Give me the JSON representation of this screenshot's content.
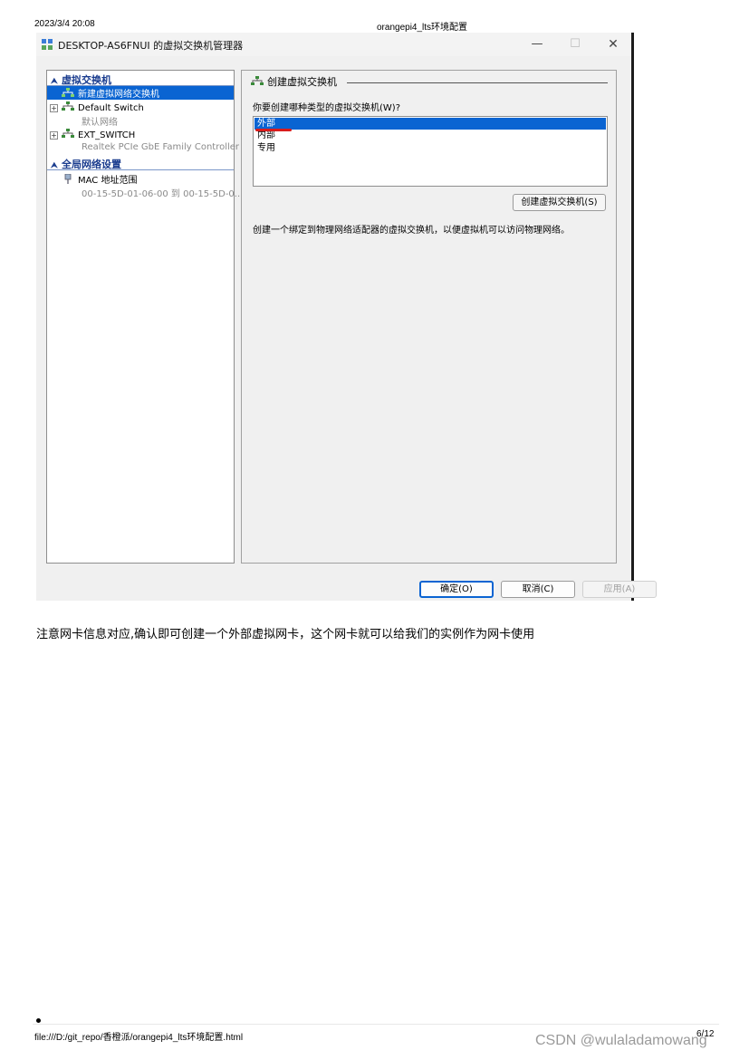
{
  "print_header": {
    "datetime": "2023/3/4 20:08",
    "doc_title": "orangepi4_lts环境配置"
  },
  "window": {
    "title": "DESKTOP-AS6FNUI 的虚拟交换机管理器",
    "minimize": "—",
    "maximize": "☐",
    "close": "✕"
  },
  "tree": {
    "section_switches": "虚拟交换机",
    "new_switch": "新建虚拟网络交换机",
    "default_switch": "Default Switch",
    "default_switch_sub": "默认网络",
    "ext_switch": "EXT_SWITCH",
    "ext_switch_sub": "Realtek PCIe GbE Family Controller",
    "section_global": "全局网络设置",
    "mac_range": "MAC 地址范围",
    "mac_range_sub": "00-15-5D-01-06-00 到 00-15-5D-0..."
  },
  "panel": {
    "header": "创建虚拟交换机",
    "question": "你要创建哪种类型的虚拟交换机(W)?",
    "options": [
      "外部",
      "内部",
      "专用"
    ],
    "selected_option": "外部",
    "create_button": "创建虚拟交换机(S)",
    "description": "创建一个绑定到物理网络适配器的虚拟交换机，以便虚拟机可以访问物理网络。"
  },
  "footer_buttons": {
    "ok": "确定(O)",
    "cancel": "取消(C)",
    "apply": "应用(A)"
  },
  "document": {
    "paragraph": "注意网卡信息对应,确认即可创建一个外部虚拟网卡，这个网卡就可以给我们的实例作为网卡使用"
  },
  "print_footer": {
    "file_path": "file:///D:/git_repo/香橙派/orangepi4_lts环境配置.html",
    "page": "6/12",
    "watermark": "CSDN @wulaladamowang"
  },
  "colors": {
    "selection": "#0a64d2",
    "section_header": "#1a3c8e",
    "annotation_mark": "#d91c1c"
  }
}
